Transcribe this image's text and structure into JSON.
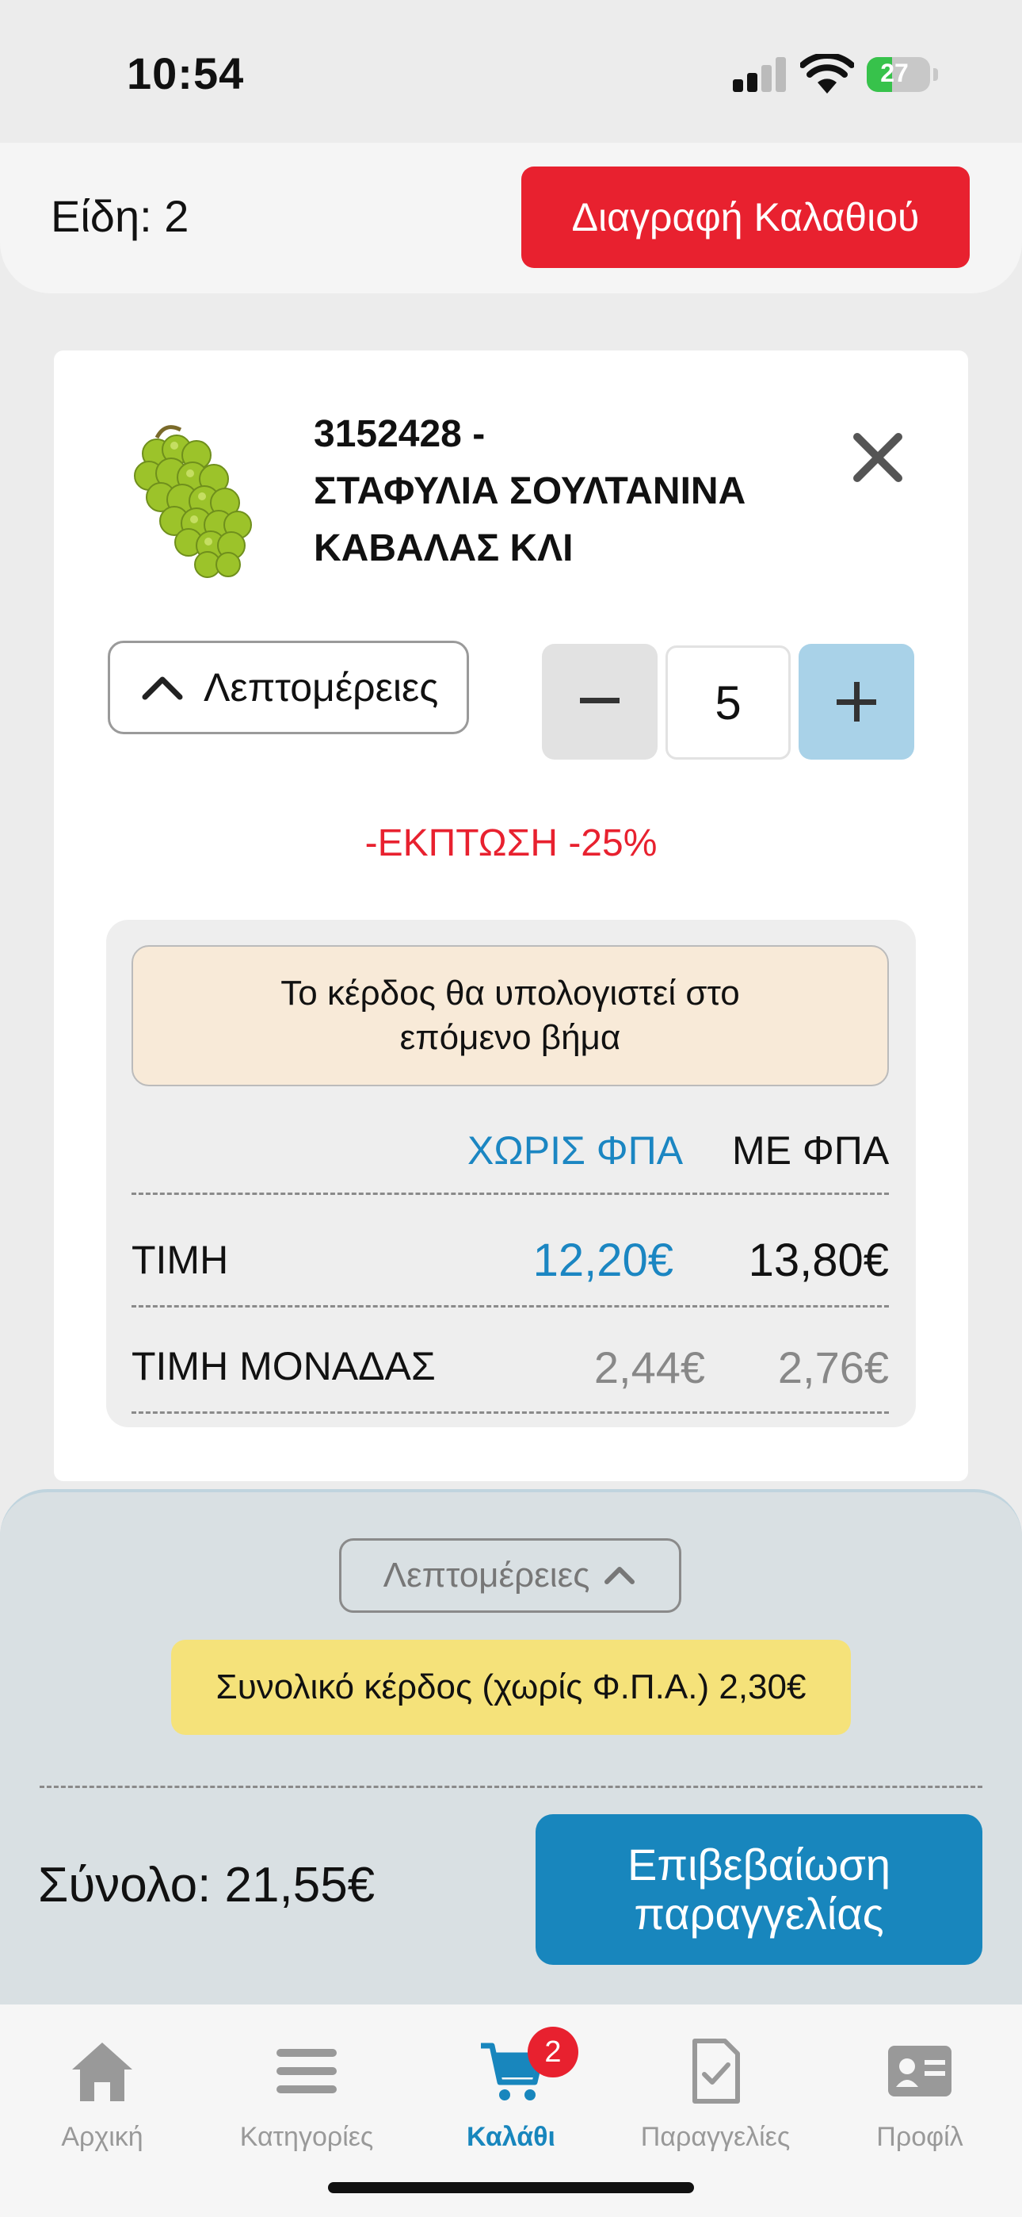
{
  "status_bar": {
    "time": "10:54",
    "battery": "27"
  },
  "header": {
    "items_count": "Είδη: 2",
    "clear_cart_label": "Διαγραφή Καλαθιού"
  },
  "product": {
    "code_line": "3152428 -",
    "name_line1": "ΣΤΑΦΥΛΙΑ ΣΟΥΛΤΑΝΙΝΑ",
    "name_line2": "ΚΑΒΑΛΑΣ ΚΛΙ",
    "details_label": "Λεπτομέρειες",
    "quantity": "5",
    "discount": "-ΕΚΠΤΩΣΗ -25%",
    "profit_note": "Το κέρδος θα υπολογιστεί στο επόμενο βήμα",
    "col_without_vat": "ΧΩΡΙΣ ΦΠΑ",
    "col_with_vat": "ΜΕ ΦΠΑ",
    "rows": [
      {
        "label": "ΤΙΜΗ",
        "without_vat": "12,20€",
        "with_vat": "13,80€"
      },
      {
        "label": "ΤΙΜΗ ΜΟΝΑΔΑΣ",
        "without_vat": "2,44€",
        "with_vat": "2,76€"
      }
    ]
  },
  "summary": {
    "details_label": "Λεπτομέρειες",
    "total_profit": "Συνολικό κέρδος (χωρίς Φ.Π.Α.) 2,30€",
    "total": "Σύνολο: 21,55€",
    "confirm_label": "Επιβεβαίωση παραγγελίας"
  },
  "tabs": [
    {
      "label": "Αρχική",
      "icon": "home-icon"
    },
    {
      "label": "Κατηγορίες",
      "icon": "menu-icon"
    },
    {
      "label": "Καλάθι",
      "icon": "cart-icon",
      "badge": "2",
      "active": true
    },
    {
      "label": "Παραγγελίες",
      "icon": "orders-icon"
    },
    {
      "label": "Προφίλ",
      "icon": "profile-card-icon"
    }
  ],
  "colors": {
    "accent_blue": "#1886bd",
    "danger_red": "#e8212f",
    "note_bg": "#f8ead8",
    "profit_bg": "#f5e27a"
  }
}
